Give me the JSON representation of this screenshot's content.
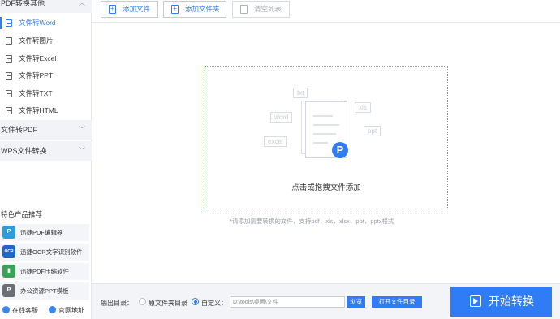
{
  "sidebar": {
    "group1_title": "PDF转换其他",
    "items": [
      {
        "label": "文件转Word",
        "active": true
      },
      {
        "label": "文件转图片"
      },
      {
        "label": "文件转Excel"
      },
      {
        "label": "文件转PPT"
      },
      {
        "label": "文件转TXT"
      },
      {
        "label": "文件转HTML"
      }
    ],
    "group2_title": "文件转PDF",
    "group3_title": "WPS文件转换",
    "promo_title": "特色产品推荐",
    "promos": [
      {
        "label": "迅捷PDF编辑器",
        "icon": "P",
        "color": "#2f9bd8"
      },
      {
        "label": "迅捷OCR文字识别软件",
        "icon": "OCR",
        "color": "#1f66c9"
      },
      {
        "label": "迅捷PDF压缩软件",
        "icon": "▮",
        "color": "#3aa156"
      },
      {
        "label": "办公资源PPT模板",
        "icon": "P",
        "color": "#6b6f75"
      }
    ],
    "footer_service": "在线客服",
    "footer_site": "官网地址"
  },
  "toolbar": {
    "add_file": "添加文件",
    "add_folder": "添加文件夹",
    "clear_list": "清空列表"
  },
  "dropzone": {
    "text": "点击或拖拽文件添加",
    "tags": [
      "txt",
      "word",
      "xls",
      "ppt",
      "excel"
    ],
    "hint": "*请添加需要转换的文件，支持pdf，xls，xlsx，ppt，pptx格式"
  },
  "output": {
    "label": "输出目录：",
    "option_original": "原文件夹目录",
    "option_custom": "自定义：",
    "path": "D:\\tools\\桌面\\文件",
    "browse": "浏览",
    "open_dir": "打开文件目录"
  },
  "start_button": "开始转换",
  "colors": {
    "accent": "#2f7cf6",
    "sidebar_group_bg": "#f1f3f6",
    "bottom_bg": "#f2f4f7"
  }
}
